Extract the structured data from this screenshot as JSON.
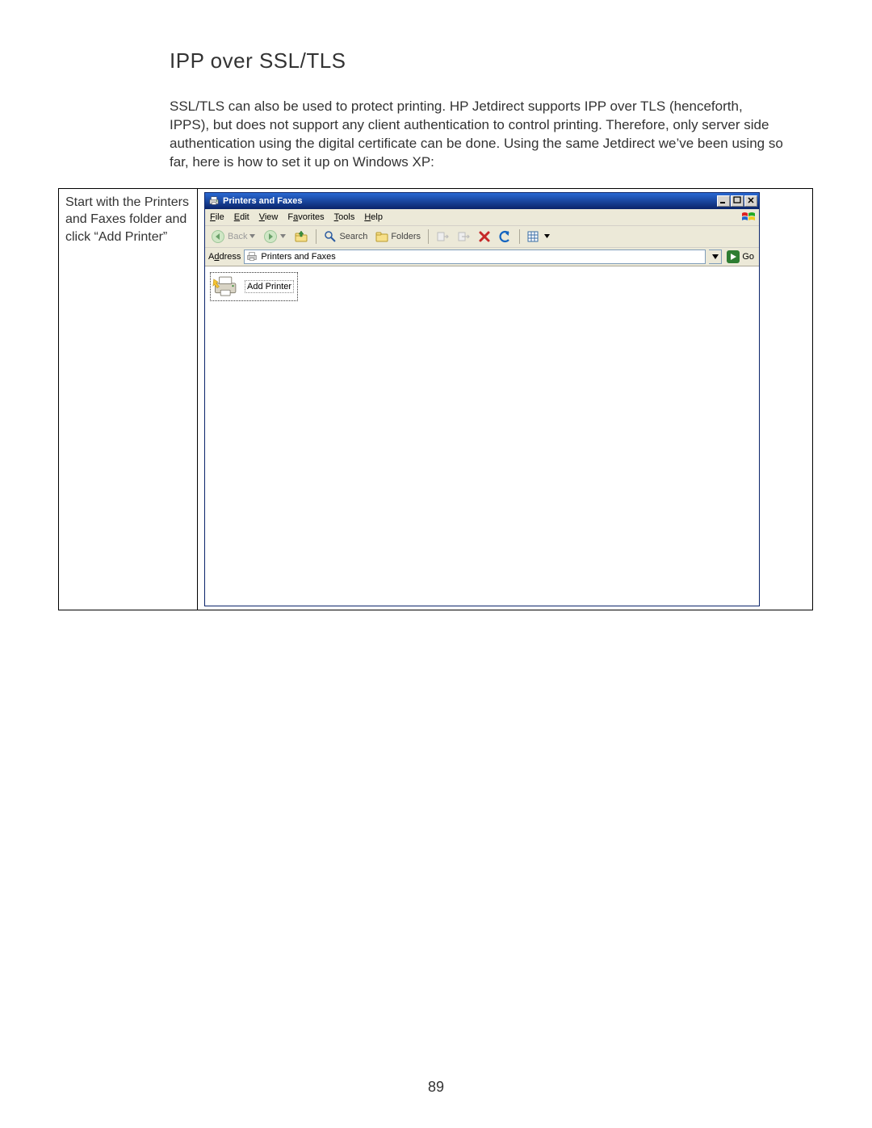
{
  "page_number": "89",
  "heading": "IPP over SSL/TLS",
  "paragraph": "SSL/TLS can also be used to protect printing.  HP Jetdirect supports IPP over TLS (henceforth, IPPS), but does not support any client authentication to control printing.  Therefore, only server side authentication using the digital certificate can be done.  Using the same Jetdirect we’ve been using so far, here is how to set it up on Windows XP:",
  "step": {
    "instruction": "Start with the Printers and Faxes folder and click “Add Printer”"
  },
  "window": {
    "title": "Printers and Faxes",
    "controls": {
      "min": "_",
      "max": "□",
      "close": "✕"
    },
    "menu": {
      "file": "File",
      "edit": "Edit",
      "view": "View",
      "favorites": "Favorites",
      "tools": "Tools",
      "help": "Help"
    },
    "toolbar": {
      "back": "Back",
      "search": "Search",
      "folders": "Folders"
    },
    "address": {
      "label": "Address",
      "label_underlined_char": "d",
      "value": "Printers and Faxes",
      "go": "Go"
    },
    "item": {
      "label": "Add Printer"
    }
  }
}
